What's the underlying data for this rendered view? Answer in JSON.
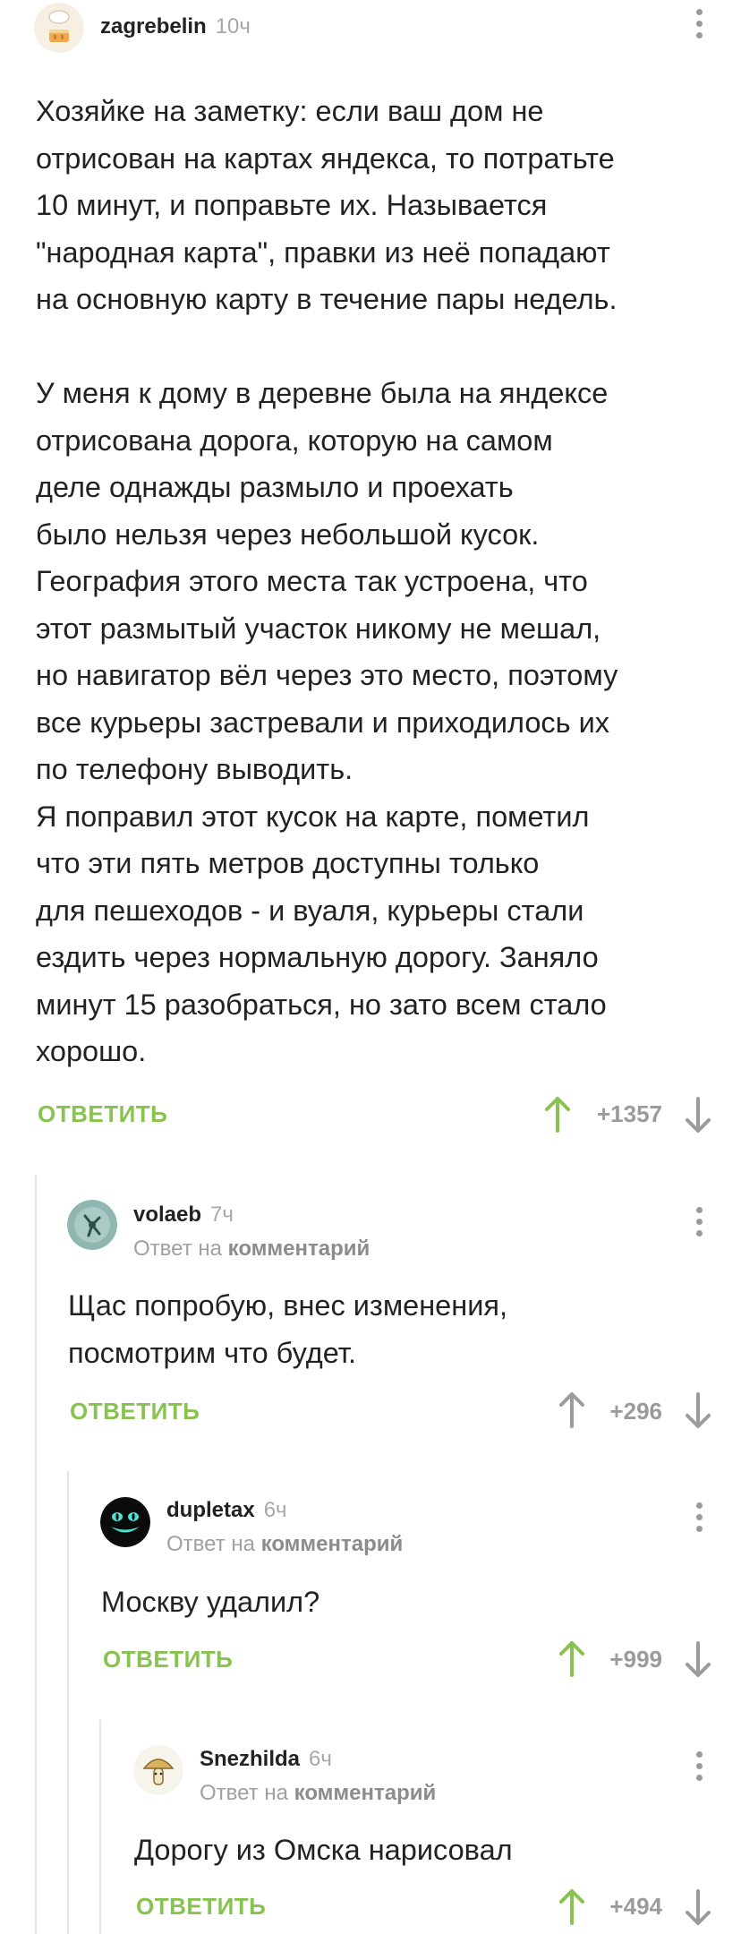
{
  "colors": {
    "accent": "#88c24f",
    "muted": "#9b9b9b",
    "text": "#222222"
  },
  "comments": [
    {
      "username": "zagrebelin",
      "time": "10ч",
      "avatar": "chef-cake-avatar",
      "text": "Хозяйке на заметку: если ваш дом не\nотрисован на картах яндекса, то потратьте\n10 минут, и поправьте их. Называется\n\"народная карта\", правки из неё попадают\nна основную карту в течение пары недель.\n\nУ меня к дому в деревне была на яндексе\nотрисована дорога, которую на самом\nделе однажды размыло и проехать\nбыло нельзя через небольшой кусок.\nГеография этого места так устроена, что\nэтот размытый участок никому не мешал,\nно навигатор вёл через это место, поэтому\nвсе курьеры застревали и приходилось их\nпо телефону выводить.\nЯ поправил этот кусок на карте, пометил\nчто эти пять метров доступны только\nдля пешеходов - и вуаля, курьеры стали\nездить через нормальную дорогу. Заняло\nминут 15 разобраться, но зато всем стало\nхорошо.",
      "reply_label": "ОТВЕТИТЬ",
      "rating": "+1357",
      "upvoted": true
    },
    {
      "username": "volaeb",
      "time": "7ч",
      "avatar": "teal-insect-avatar",
      "reply_to_prefix": "Ответ на",
      "reply_to_link": "комментарий",
      "text": "Щас попробую, внес изменения,\nпосмотрим что будет.",
      "reply_label": "ОТВЕТИТЬ",
      "rating": "+296",
      "upvoted": false
    },
    {
      "username": "dupletax",
      "time": "6ч",
      "avatar": "cheshire-cat-avatar",
      "reply_to_prefix": "Ответ на",
      "reply_to_link": "комментарий",
      "text": "Москву удалил?",
      "reply_label": "ОТВЕТИТЬ",
      "rating": "+999",
      "upvoted": true
    },
    {
      "username": "Snezhilda",
      "time": "6ч",
      "avatar": "mushroom-avatar",
      "reply_to_prefix": "Ответ на",
      "reply_to_link": "комментарий",
      "text": "Дорогу из Омска нарисовал",
      "reply_label": "ОТВЕТИТЬ",
      "rating": "+494",
      "upvoted": true
    }
  ]
}
